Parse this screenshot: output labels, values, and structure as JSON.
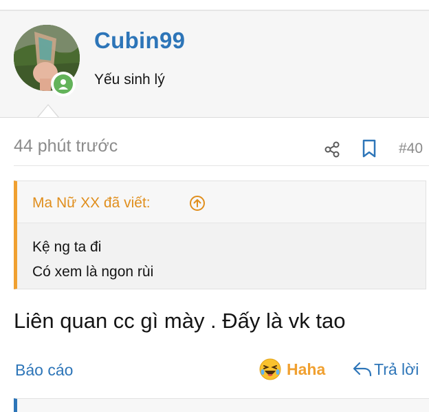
{
  "user": {
    "username": "Cubin99",
    "title": "Yếu sinh lý",
    "status_color": "#63b35a"
  },
  "post": {
    "time": "44 phút trước",
    "number": "#40",
    "content": "Liên quan cc gì mày . Đấy là vk tao"
  },
  "quote": {
    "author": "Ma Nữ XX đã viết:",
    "lines": [
      "Kệ ng ta đi",
      "Có xem là ngon rùi"
    ]
  },
  "actions": {
    "report": "Báo cáo",
    "reaction": "Haha",
    "reply": "Trả lời"
  },
  "icons": [
    "share-icon",
    "bookmark-icon",
    "quote-expand-icon",
    "haha-emoji-icon",
    "reply-icon"
  ],
  "colors": {
    "link": "#2d75b8",
    "quote_accent": "#f0a030",
    "muted": "#8b8b8b"
  }
}
